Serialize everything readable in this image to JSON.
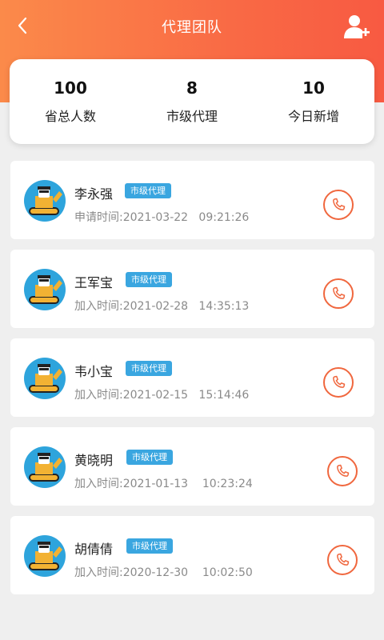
{
  "header": {
    "title": "代理团队",
    "back_icon": "chevron-left-icon",
    "add_icon": "add-user-icon",
    "gradient": [
      "#fb8a4a",
      "#f85a42"
    ]
  },
  "stats": [
    {
      "value": "100",
      "label": "省总人数"
    },
    {
      "value": "8",
      "label": "市级代理"
    },
    {
      "value": "10",
      "label": "今日新增"
    }
  ],
  "agents": [
    {
      "name": "李永强",
      "badge": "市级代理",
      "time_label": "申请时间:",
      "time": "2021-03-22   09:21:26"
    },
    {
      "name": "王军宝",
      "badge": "市级代理",
      "time_label": "加入时间:",
      "time": "2021-02-28   14:35:13"
    },
    {
      "name": "韦小宝",
      "badge": "市级代理",
      "time_label": "加入时间:",
      "time": "2021-02-15   15:14:46"
    },
    {
      "name": "黄晓明",
      "badge": "市级代理",
      "time_label": "加入时间:",
      "time": "2021-01-13    10:23:24"
    },
    {
      "name": "胡倩倩",
      "badge": "市级代理",
      "time_label": "加入时间:",
      "time": "2020-12-30    10:02:50"
    }
  ],
  "colors": {
    "accent": "#f0673e",
    "badge": "#3aa6e0",
    "avatar_bg": "#2ea4dc"
  }
}
